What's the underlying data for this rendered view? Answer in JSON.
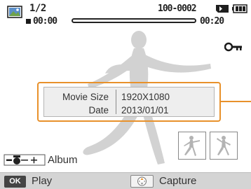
{
  "status": {
    "file_counter": "1/2",
    "file_number": "100-0002",
    "time_elapsed": "00:00",
    "time_total": "00:20",
    "progress": 0
  },
  "info": {
    "rows": [
      {
        "label": "Movie Size",
        "value": "1920X1080"
      },
      {
        "label": "Date",
        "value": "2013/01/01"
      }
    ]
  },
  "album": {
    "label": "Album"
  },
  "bottom_bar": {
    "ok_key": "OK",
    "play_label": "Play",
    "capture_label": "Capture"
  },
  "colors": {
    "accent": "#e8912b",
    "silhouette": "#d2d2d2"
  },
  "icons": [
    "thumbnail-icon",
    "memory-card-icon",
    "battery-icon",
    "stop-icon",
    "protect-key-icon",
    "zoom-icon",
    "nav-key-icon"
  ]
}
